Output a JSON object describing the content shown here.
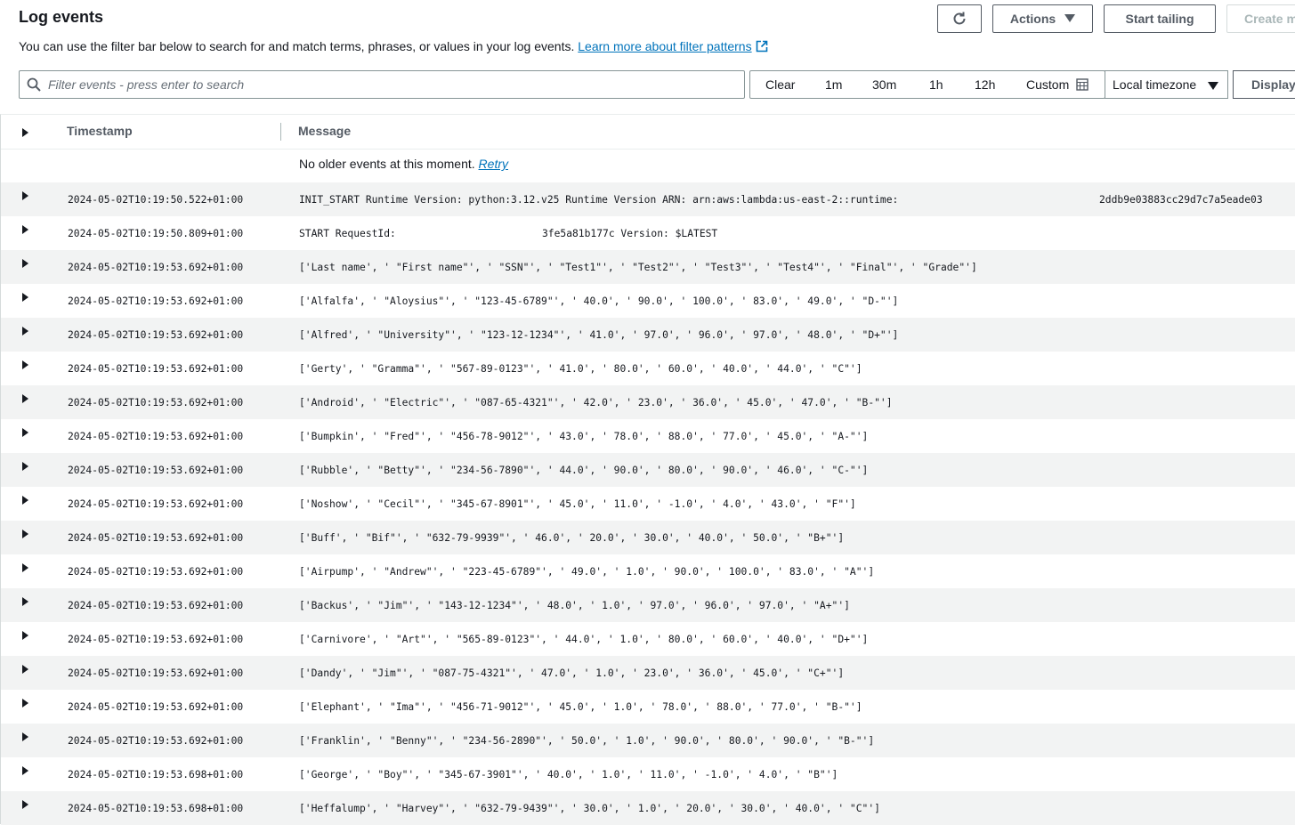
{
  "header": {
    "title": "Log events",
    "description": "You can use the filter bar below to search for and match terms, phrases, or values in your log events.",
    "learn_more": "Learn more about filter patterns"
  },
  "toolbar": {
    "actions_label": "Actions",
    "start_tailing_label": "Start tailing",
    "create_label": "Create m"
  },
  "filter": {
    "placeholder": "Filter events - press enter to search",
    "value": ""
  },
  "time_range": {
    "clear": "Clear",
    "options": [
      "1m",
      "30m",
      "1h",
      "12h"
    ],
    "custom": "Custom",
    "timezone": "Local timezone",
    "display": "Display"
  },
  "table": {
    "col_timestamp": "Timestamp",
    "col_message": "Message",
    "no_older": "No older events at this moment.",
    "retry": "Retry",
    "rows": [
      {
        "ts": "2024-05-02T10:19:50.522+01:00",
        "msg": "INIT_START Runtime Version: python:3.12.v25 Runtime Version ARN: arn:aws:lambda:us-east-2::runtime:",
        "msg_tail": "2ddb9e03883cc29d7c7a5eade03"
      },
      {
        "ts": "2024-05-02T10:19:50.809+01:00",
        "msg": "START RequestId:",
        "msg_tail": "3fe5a81b177c Version: $LATEST"
      },
      {
        "ts": "2024-05-02T10:19:53.692+01:00",
        "msg": "['Last name', ' \"First name\"', ' \"SSN\"', ' \"Test1\"', ' \"Test2\"', ' \"Test3\"', ' \"Test4\"', ' \"Final\"', ' \"Grade\"']"
      },
      {
        "ts": "2024-05-02T10:19:53.692+01:00",
        "msg": "['Alfalfa', ' \"Aloysius\"', ' \"123-45-6789\"', ' 40.0', ' 90.0', ' 100.0', ' 83.0', ' 49.0', ' \"D-\"']"
      },
      {
        "ts": "2024-05-02T10:19:53.692+01:00",
        "msg": "['Alfred', ' \"University\"', ' \"123-12-1234\"', ' 41.0', ' 97.0', ' 96.0', ' 97.0', ' 48.0', ' \"D+\"']"
      },
      {
        "ts": "2024-05-02T10:19:53.692+01:00",
        "msg": "['Gerty', ' \"Gramma\"', ' \"567-89-0123\"', ' 41.0', ' 80.0', ' 60.0', ' 40.0', ' 44.0', ' \"C\"']"
      },
      {
        "ts": "2024-05-02T10:19:53.692+01:00",
        "msg": "['Android', ' \"Electric\"', ' \"087-65-4321\"', ' 42.0', ' 23.0', ' 36.0', ' 45.0', ' 47.0', ' \"B-\"']"
      },
      {
        "ts": "2024-05-02T10:19:53.692+01:00",
        "msg": "['Bumpkin', ' \"Fred\"', ' \"456-78-9012\"', ' 43.0', ' 78.0', ' 88.0', ' 77.0', ' 45.0', ' \"A-\"']"
      },
      {
        "ts": "2024-05-02T10:19:53.692+01:00",
        "msg": "['Rubble', ' \"Betty\"', ' \"234-56-7890\"', ' 44.0', ' 90.0', ' 80.0', ' 90.0', ' 46.0', ' \"C-\"']"
      },
      {
        "ts": "2024-05-02T10:19:53.692+01:00",
        "msg": "['Noshow', ' \"Cecil\"', ' \"345-67-8901\"', ' 45.0', ' 11.0', ' -1.0', ' 4.0', ' 43.0', ' \"F\"']"
      },
      {
        "ts": "2024-05-02T10:19:53.692+01:00",
        "msg": "['Buff', ' \"Bif\"', ' \"632-79-9939\"', ' 46.0', ' 20.0', ' 30.0', ' 40.0', ' 50.0', ' \"B+\"']"
      },
      {
        "ts": "2024-05-02T10:19:53.692+01:00",
        "msg": "['Airpump', ' \"Andrew\"', ' \"223-45-6789\"', ' 49.0', ' 1.0', ' 90.0', ' 100.0', ' 83.0', ' \"A\"']"
      },
      {
        "ts": "2024-05-02T10:19:53.692+01:00",
        "msg": "['Backus', ' \"Jim\"', ' \"143-12-1234\"', ' 48.0', ' 1.0', ' 97.0', ' 96.0', ' 97.0', ' \"A+\"']"
      },
      {
        "ts": "2024-05-02T10:19:53.692+01:00",
        "msg": "['Carnivore', ' \"Art\"', ' \"565-89-0123\"', ' 44.0', ' 1.0', ' 80.0', ' 60.0', ' 40.0', ' \"D+\"']"
      },
      {
        "ts": "2024-05-02T10:19:53.692+01:00",
        "msg": "['Dandy', ' \"Jim\"', ' \"087-75-4321\"', ' 47.0', ' 1.0', ' 23.0', ' 36.0', ' 45.0', ' \"C+\"']"
      },
      {
        "ts": "2024-05-02T10:19:53.692+01:00",
        "msg": "['Elephant', ' \"Ima\"', ' \"456-71-9012\"', ' 45.0', ' 1.0', ' 78.0', ' 88.0', ' 77.0', ' \"B-\"']"
      },
      {
        "ts": "2024-05-02T10:19:53.692+01:00",
        "msg": "['Franklin', ' \"Benny\"', ' \"234-56-2890\"', ' 50.0', ' 1.0', ' 90.0', ' 80.0', ' 90.0', ' \"B-\"']"
      },
      {
        "ts": "2024-05-02T10:19:53.698+01:00",
        "msg": "['George', ' \"Boy\"', ' \"345-67-3901\"', ' 40.0', ' 1.0', ' 11.0', ' -1.0', ' 4.0', ' \"B\"']"
      },
      {
        "ts": "2024-05-02T10:19:53.698+01:00",
        "msg": "['Heffalump', ' \"Harvey\"', ' \"632-79-9439\"', ' 30.0', ' 1.0', ' 20.0', ' 30.0', ' 40.0', ' \"C\"']"
      }
    ]
  },
  "icons": {
    "refresh": "refresh-icon",
    "caret": "caret-down-icon",
    "external": "external-link-icon",
    "search": "search-icon",
    "calendar": "calendar-icon",
    "expand": "expand-triangle-icon"
  },
  "colors": {
    "link": "#0073bb",
    "row_alt": "#f2f3f3",
    "text": "#16191f",
    "button_text": "#545b64"
  }
}
